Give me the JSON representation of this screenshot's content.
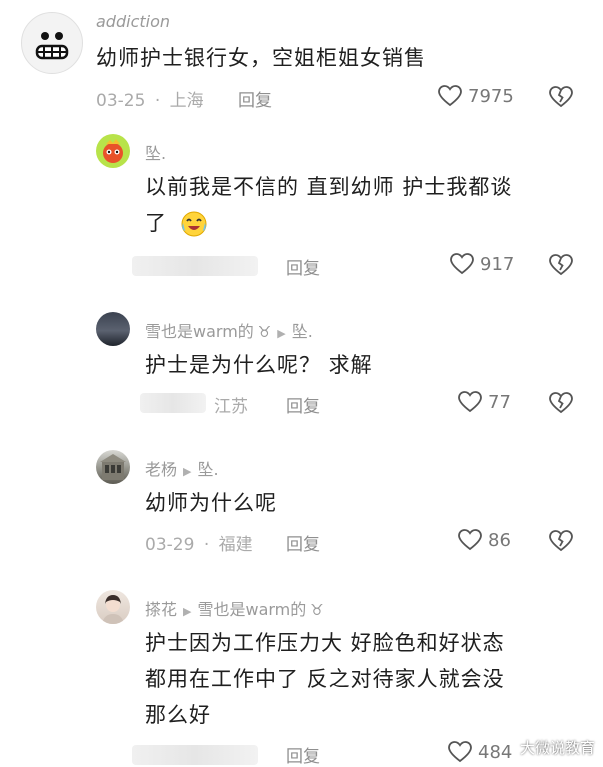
{
  "comments": [
    {
      "user": "addiction",
      "text": "幼师护士银行女，空姐柜姐女销售",
      "date": "03-25",
      "location": "上海",
      "reply": "回复",
      "likes": "7975"
    },
    {
      "user": "坠.",
      "text_line1": "以前我是不信的 直到幼师 护士我都谈",
      "text_line2": "了",
      "reply": "回复",
      "likes": "917"
    },
    {
      "user": "雪也是warm的",
      "user_tag": "♉",
      "reply_to": "坠.",
      "text": "护士是为什么呢？ 求解",
      "location": "江苏",
      "reply": "回复",
      "likes": "77"
    },
    {
      "user": "老杨",
      "reply_to": "坠.",
      "text": "幼师为什么呢",
      "date": "03-29",
      "location": "福建",
      "reply": "回复",
      "likes": "86"
    },
    {
      "user": "搽花",
      "reply_to": "雪也是warm的",
      "reply_to_tag": "♉",
      "text_line1": "护士因为工作压力大  好脸色和好状态",
      "text_line2": "都用在工作中了  反之对待家人就会没",
      "text_line3": "那么好",
      "reply": "回复",
      "likes": "484"
    }
  ],
  "separator": "·",
  "watermark": "大微说教育",
  "colors": {
    "meta": "#aaaaaa",
    "text": "#1f1f1f",
    "name": "#9a9a9a"
  }
}
